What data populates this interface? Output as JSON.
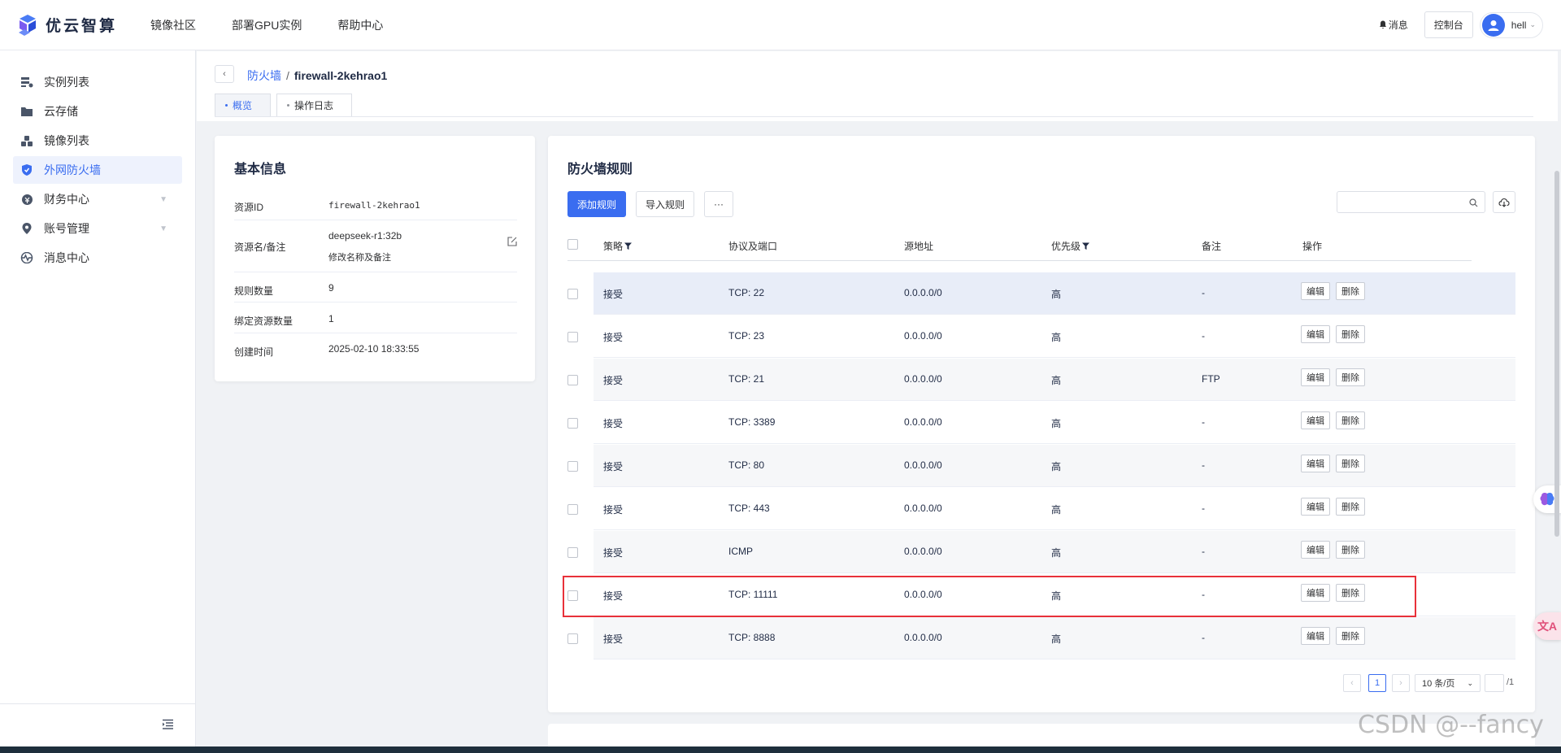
{
  "app": {
    "logo_text": "优云智算",
    "nav": [
      "镜像社区",
      "部署GPU实例",
      "帮助中心"
    ],
    "messages_label": "消息",
    "console_label": "控制台",
    "user_name": "hell"
  },
  "sidebar": {
    "items": [
      {
        "label": "实例列表",
        "icon": "server-list-icon"
      },
      {
        "label": "云存储",
        "icon": "folder-icon"
      },
      {
        "label": "镜像列表",
        "icon": "cubes-icon"
      },
      {
        "label": "外网防火墙",
        "icon": "shield-icon",
        "active": true
      },
      {
        "label": "财务中心",
        "icon": "finance-icon",
        "expandable": true
      },
      {
        "label": "账号管理",
        "icon": "location-icon",
        "expandable": true
      },
      {
        "label": "消息中心",
        "icon": "pulse-icon"
      }
    ]
  },
  "breadcrumb": {
    "parent": "防火墙",
    "separator": "/",
    "current": "firewall-2kehrao1"
  },
  "tabs": [
    "概览",
    "操作日志"
  ],
  "basic_info": {
    "title": "基本信息",
    "rows": [
      {
        "key": "资源ID",
        "value": "firewall-2kehrao1"
      },
      {
        "key": "资源名/备注",
        "value": "deepseek-r1:32b",
        "hint": "修改名称及备注"
      },
      {
        "key": "规则数量",
        "value": "9"
      },
      {
        "key": "绑定资源数量",
        "value": "1"
      },
      {
        "key": "创建时间",
        "value": "2025-02-10 18:33:55"
      }
    ]
  },
  "rules": {
    "title": "防火墙规则",
    "add_label": "添加规则",
    "import_label": "导入规则",
    "more_label": "···",
    "search_value": "",
    "columns": [
      "策略",
      "协议及端口",
      "源地址",
      "优先级",
      "备注",
      "操作"
    ],
    "edit_label": "编辑",
    "delete_label": "删除",
    "rows": [
      {
        "policy": "接受",
        "port": "TCP: 22",
        "source": "0.0.0.0/0",
        "priority": "高",
        "note": "-"
      },
      {
        "policy": "接受",
        "port": "TCP: 23",
        "source": "0.0.0.0/0",
        "priority": "高",
        "note": "-"
      },
      {
        "policy": "接受",
        "port": "TCP: 21",
        "source": "0.0.0.0/0",
        "priority": "高",
        "note": "FTP"
      },
      {
        "policy": "接受",
        "port": "TCP: 3389",
        "source": "0.0.0.0/0",
        "priority": "高",
        "note": "-"
      },
      {
        "policy": "接受",
        "port": "TCP: 80",
        "source": "0.0.0.0/0",
        "priority": "高",
        "note": "-"
      },
      {
        "policy": "接受",
        "port": "TCP: 443",
        "source": "0.0.0.0/0",
        "priority": "高",
        "note": "-"
      },
      {
        "policy": "接受",
        "port": "ICMP",
        "source": "0.0.0.0/0",
        "priority": "高",
        "note": "-"
      },
      {
        "policy": "接受",
        "port": "TCP: 11111",
        "source": "0.0.0.0/0",
        "priority": "高",
        "note": "-"
      },
      {
        "policy": "接受",
        "port": "TCP: 8888",
        "source": "0.0.0.0/0",
        "priority": "高",
        "note": "-"
      }
    ],
    "pager": {
      "prev": "‹",
      "current_page": "1",
      "next": "›",
      "page_size": "10 条/页",
      "jump_value": "",
      "total_pages": "/1"
    }
  },
  "watermark": "CSDN @--fancy",
  "colors": {
    "accent": "#3a6df0",
    "highlight_box": "#e8313a"
  }
}
